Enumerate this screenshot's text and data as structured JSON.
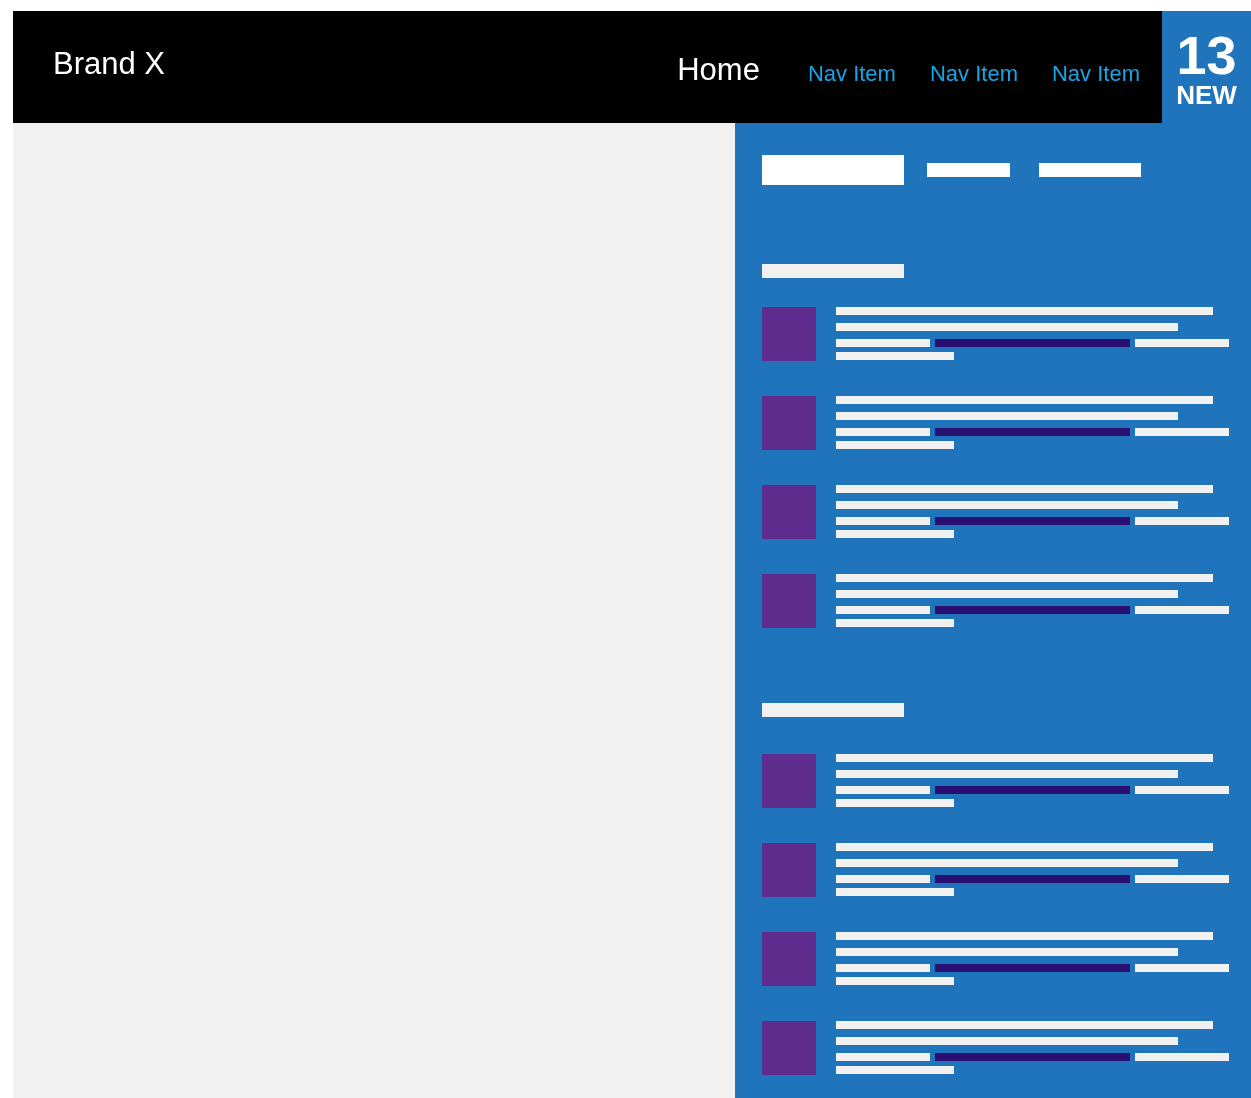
{
  "header": {
    "brand": "Brand X",
    "nav": [
      {
        "label": "Home",
        "selected": true
      },
      {
        "label": "Nav Item",
        "selected": false
      },
      {
        "label": "Nav Item",
        "selected": false
      },
      {
        "label": "Nav Item",
        "selected": false
      }
    ],
    "badge": {
      "count": "13",
      "label": "NEW"
    }
  },
  "sidebar": {
    "tabs": [
      {
        "selected": true
      },
      {
        "selected": false
      },
      {
        "selected": false
      }
    ],
    "sections": [
      {
        "items": [
          {
            "kind": "media-row"
          },
          {
            "kind": "media-row"
          },
          {
            "kind": "media-row"
          },
          {
            "kind": "media-row"
          }
        ]
      },
      {
        "items": [
          {
            "kind": "media-row"
          },
          {
            "kind": "media-row"
          },
          {
            "kind": "media-row"
          },
          {
            "kind": "media-row"
          }
        ]
      }
    ]
  }
}
